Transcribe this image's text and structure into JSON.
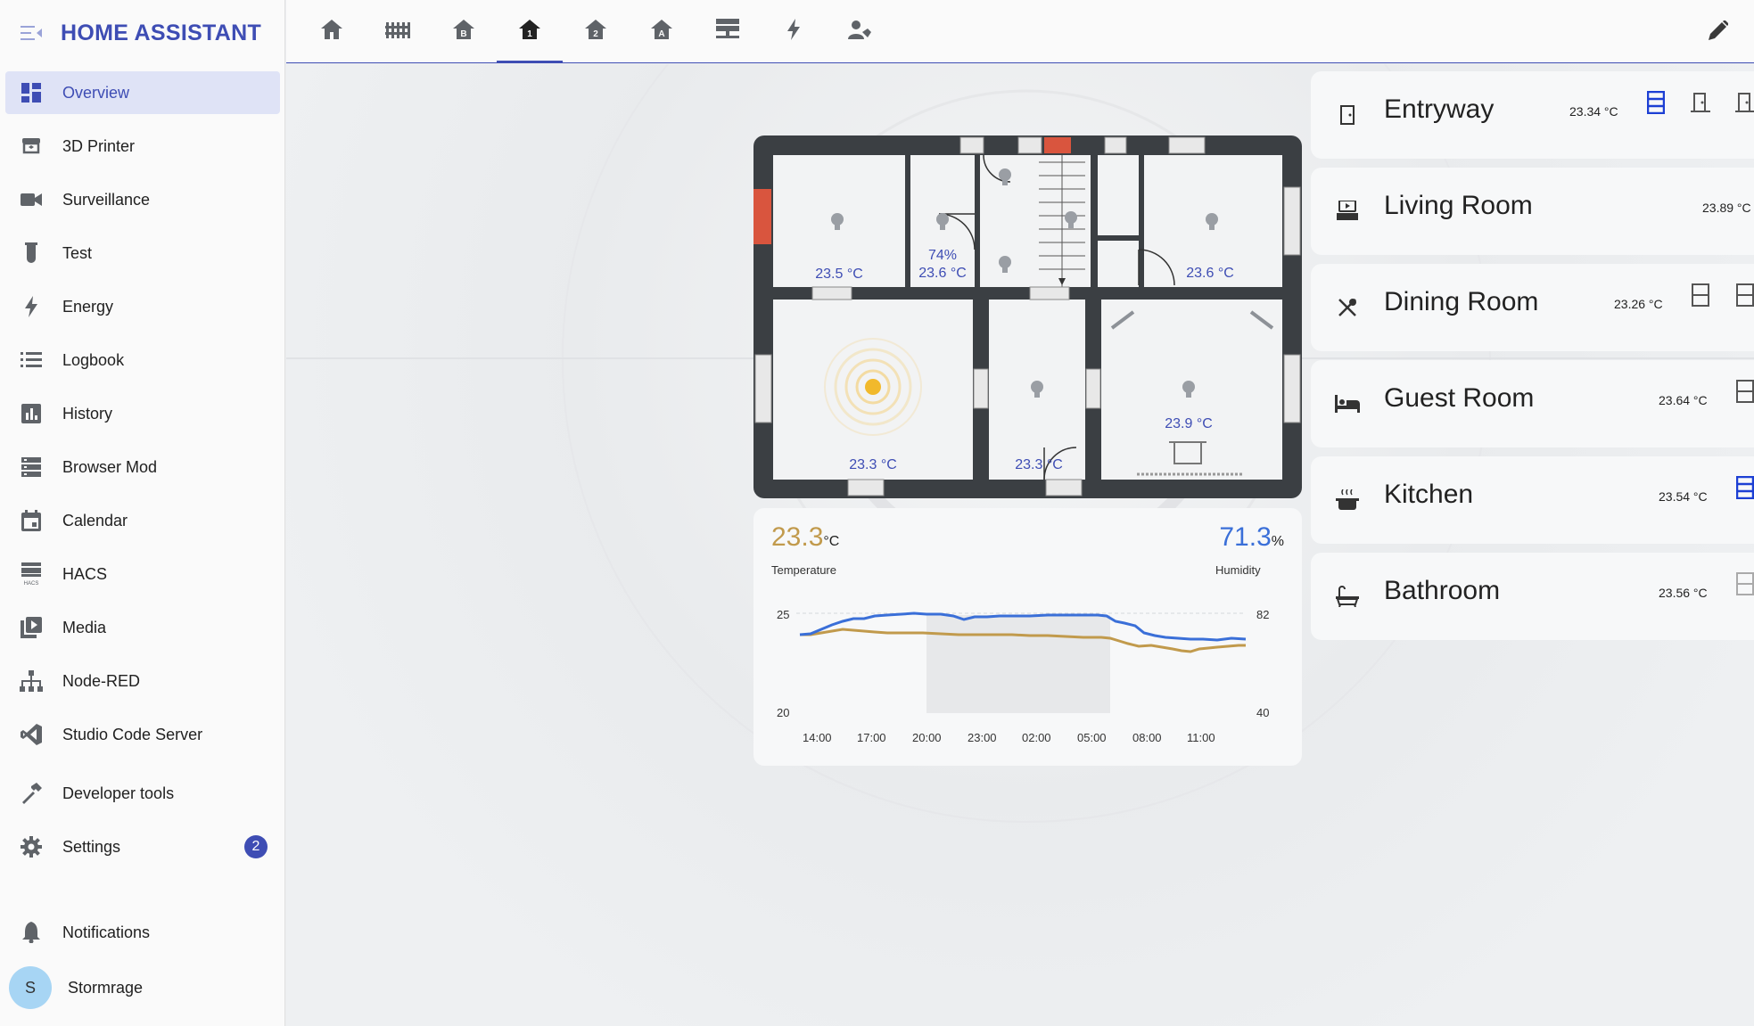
{
  "app": {
    "title": "HOME ASSISTANT"
  },
  "sidebar": {
    "items": [
      {
        "label": "Overview",
        "icon": "dashboard-icon"
      },
      {
        "label": "3D Printer",
        "icon": "printer-3d-icon"
      },
      {
        "label": "Surveillance",
        "icon": "video-camera-icon"
      },
      {
        "label": "Test",
        "icon": "test-tube-icon"
      },
      {
        "label": "Energy",
        "icon": "lightning-bolt-icon"
      },
      {
        "label": "Logbook",
        "icon": "list-icon"
      },
      {
        "label": "History",
        "icon": "chart-box-icon"
      },
      {
        "label": "Browser Mod",
        "icon": "server-icon"
      },
      {
        "label": "Calendar",
        "icon": "calendar-icon"
      },
      {
        "label": "HACS",
        "icon": "hacs-icon"
      },
      {
        "label": "Media",
        "icon": "play-box-icon"
      },
      {
        "label": "Node-RED",
        "icon": "sitemap-icon"
      },
      {
        "label": "Studio Code Server",
        "icon": "vscode-icon"
      },
      {
        "label": "Developer tools",
        "icon": "hammer-icon"
      },
      {
        "label": "Settings",
        "icon": "gear-icon",
        "badge": "2"
      }
    ],
    "notifications": "Notifications",
    "user": {
      "initial": "S",
      "name": "Stormrage"
    }
  },
  "topbar": {
    "tabs": [
      "home-icon",
      "fence-icon",
      "home-floor-b-icon",
      "home-floor-1-icon",
      "home-floor-2-icon",
      "home-floor-a-icon",
      "server-icon",
      "lightning-bolt-icon",
      "account-wrench-icon"
    ],
    "active_tab": 3
  },
  "floorplan": {
    "labels": [
      "23.5 °C",
      "74%",
      "23.6 °C",
      "23.6 °C",
      "23.3 °C",
      "23.3 °C",
      "23.9 °C"
    ]
  },
  "sensor": {
    "temperature": {
      "value": "23.3",
      "unit": "°C",
      "name": "Temperature",
      "color": "#c19a4c"
    },
    "humidity": {
      "value": "71.3",
      "unit": "%",
      "name": "Humidity",
      "color": "#3a6fd8"
    },
    "axis": {
      "left_top": "25",
      "left_bottom": "20",
      "right_top": "82",
      "right_bottom": "40"
    },
    "times": [
      "14:00",
      "17:00",
      "20:00",
      "23:00",
      "02:00",
      "05:00",
      "08:00",
      "11:00"
    ]
  },
  "rooms": [
    {
      "name": "Entryway",
      "temp": "23.34 °C",
      "icon": "door-icon",
      "controls": [
        "window-open-icon",
        "door-icon",
        "door-icon",
        "lightbulb-group-icon"
      ]
    },
    {
      "name": "Living Room",
      "temp": "23.89 °C",
      "icon": "sofa-tv-icon",
      "controls": [
        "lightbulb-group-icon"
      ]
    },
    {
      "name": "Dining Room",
      "temp": "23.26 °C",
      "icon": "silverware-icon",
      "controls": [
        "window-closed-icon",
        "window-closed-icon",
        "lightbulb-group-icon"
      ]
    },
    {
      "name": "Guest Room",
      "temp": "23.64 °C",
      "icon": "bed-icon",
      "controls": [
        "window-closed-icon",
        "lightbulb-group-icon"
      ]
    },
    {
      "name": "Kitchen",
      "temp": "23.54 °C",
      "icon": "pot-steam-icon",
      "controls": [
        "window-open-icon",
        "lightbulb-group-icon"
      ]
    },
    {
      "name": "Bathroom",
      "temp": "23.56 °C",
      "icon": "bathtub-icon",
      "controls": [
        "window-closed-icon",
        "lightbulb-group-icon"
      ]
    }
  ],
  "colors": {
    "accent": "#3e4db4",
    "active_blue": "#1c3fd4",
    "icon_gray": "#5f6368"
  }
}
